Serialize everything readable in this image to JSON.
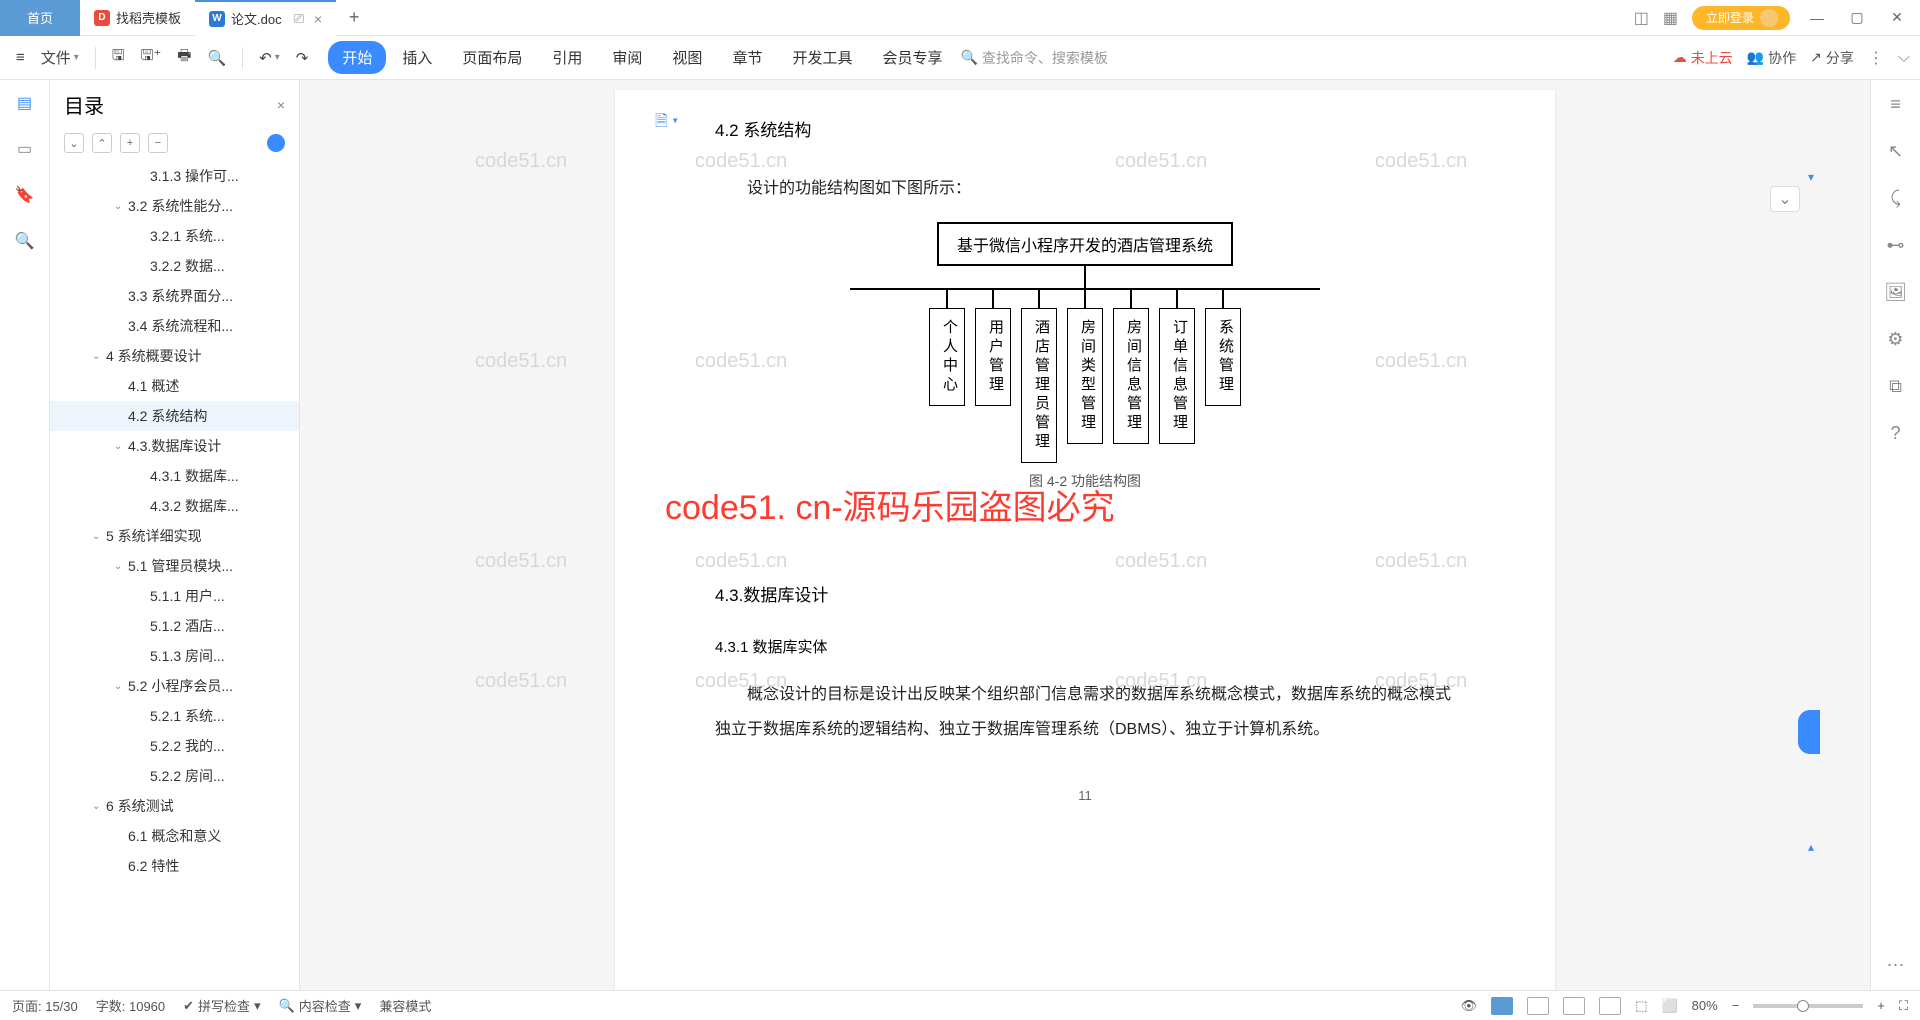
{
  "titlebar": {
    "home": "首页",
    "tab1": "找稻壳模板",
    "tab2": "论文.doc",
    "login": "立即登录"
  },
  "ribbon": {
    "file": "文件",
    "tabs": [
      "开始",
      "插入",
      "页面布局",
      "引用",
      "审阅",
      "视图",
      "章节",
      "开发工具",
      "会员专享"
    ],
    "search_placeholder": "查找命令、搜索模板",
    "cloud": "未上云",
    "coop": "协作",
    "share": "分享"
  },
  "outline": {
    "title": "目录",
    "items": [
      {
        "level": 3,
        "label": "3.1.3 操作可..."
      },
      {
        "level": 2,
        "label": "3.2 系统性能分...",
        "expanded": true
      },
      {
        "level": 3,
        "label": "3.2.1 系统..."
      },
      {
        "level": 3,
        "label": "3.2.2 数据..."
      },
      {
        "level": 2,
        "label": "3.3 系统界面分..."
      },
      {
        "level": 2,
        "label": "3.4 系统流程和..."
      },
      {
        "level": 1,
        "label": "4 系统概要设计",
        "expanded": true
      },
      {
        "level": 2,
        "label": "4.1 概述"
      },
      {
        "level": 2,
        "label": "4.2 系统结构",
        "current": true
      },
      {
        "level": 2,
        "label": "4.3.数据库设计",
        "expanded": true
      },
      {
        "level": 3,
        "label": "4.3.1 数据库..."
      },
      {
        "level": 3,
        "label": "4.3.2 数据库..."
      },
      {
        "level": 1,
        "label": "5 系统详细实现",
        "expanded": true
      },
      {
        "level": 2,
        "label": "5.1 管理员模块...",
        "expanded": true
      },
      {
        "level": 3,
        "label": "5.1.1 用户..."
      },
      {
        "level": 3,
        "label": "5.1.2 酒店..."
      },
      {
        "level": 3,
        "label": "5.1.3 房间..."
      },
      {
        "level": 2,
        "label": "5.2 小程序会员...",
        "expanded": true
      },
      {
        "level": 3,
        "label": "5.2.1 系统..."
      },
      {
        "level": 3,
        "label": "5.2.2 我的..."
      },
      {
        "level": 3,
        "label": "5.2.2 房间..."
      },
      {
        "level": 1,
        "label": "6 系统测试",
        "expanded": true
      },
      {
        "level": 2,
        "label": "6.1 概念和意义"
      },
      {
        "level": 2,
        "label": "6.2 特性"
      }
    ]
  },
  "doc": {
    "h_4_2": "4.2 系统结构",
    "p_intro": "设计的功能结构图如下图所示：",
    "diagram_root": "基于微信小程序开发的酒店管理系统",
    "diagram_boxes": [
      "个人中心",
      "用户管理",
      "酒店管理员管理",
      "房间类型管理",
      "房间信息管理",
      "订单信息管理",
      "系统管理"
    ],
    "caption": "图 4-2 功能结构图",
    "watermark_big": "code51. cn-源码乐园盗图必究",
    "h_4_3": "4.3.数据库设计",
    "h_4_3_1": "4.3.1 数据库实体",
    "p_body": "概念设计的目标是设计出反映某个组织部门信息需求的数据库系统概念模式，数据库系统的概念模式独立于数据库系统的逻辑结构、独立于数据库管理系统（DBMS）、独立于计算机系统。",
    "page_num": "11",
    "wm_text": "code51.cn"
  },
  "status": {
    "page": "页面: 15/30",
    "words": "字数: 10960",
    "spell": "拼写检查",
    "content": "内容检查",
    "compat": "兼容模式",
    "zoom": "80%"
  }
}
